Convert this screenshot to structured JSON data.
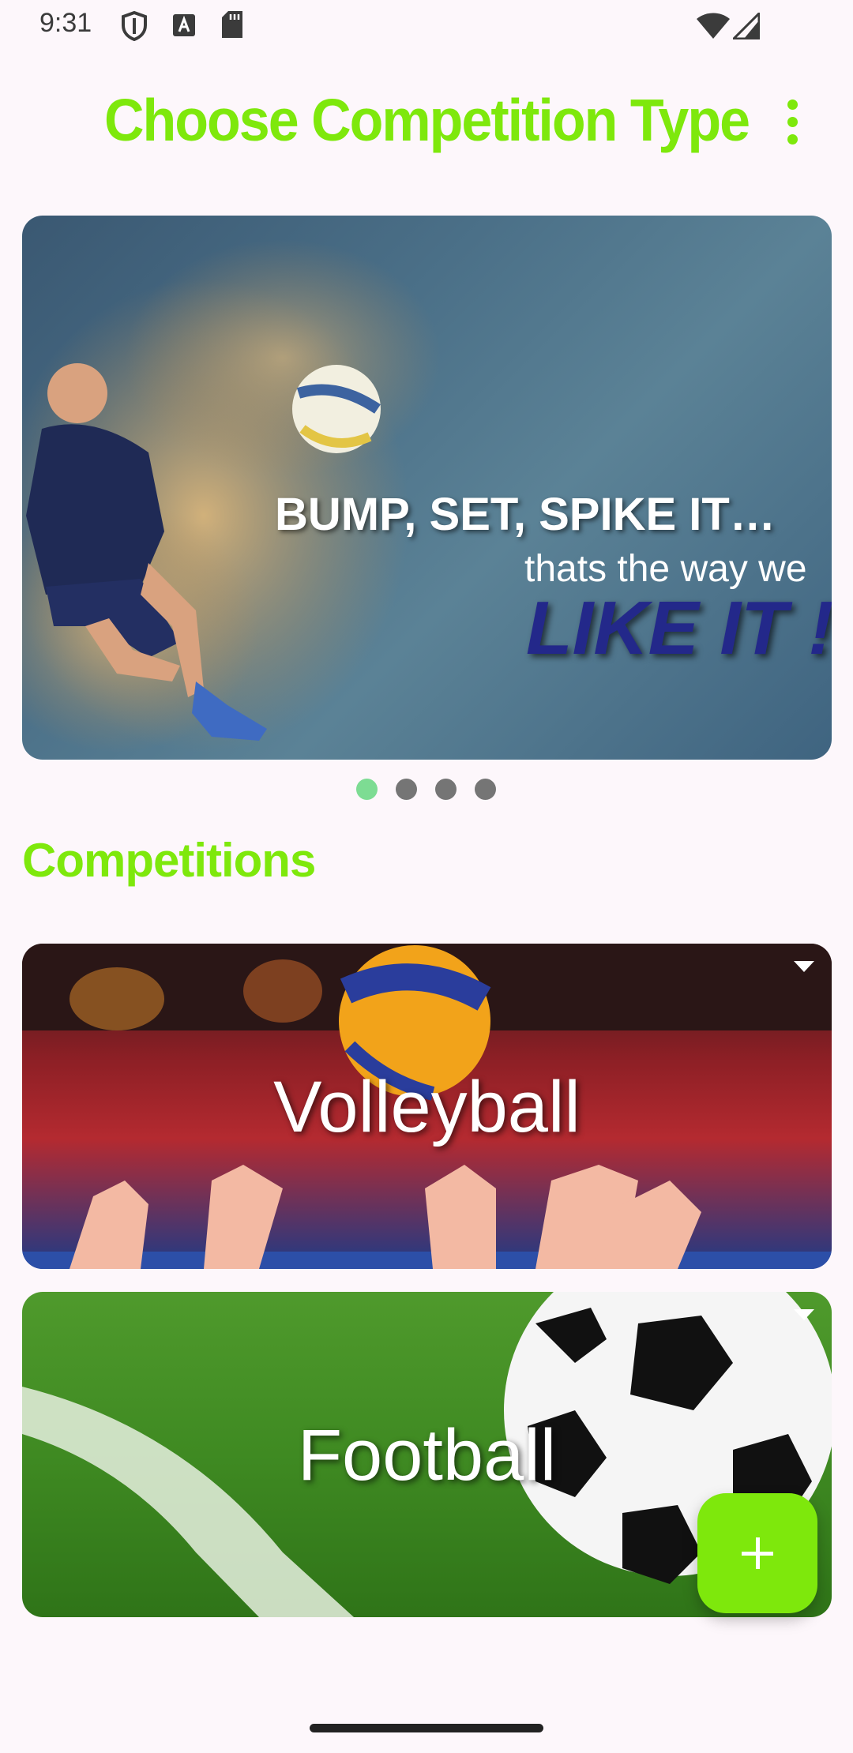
{
  "status_bar": {
    "time": "9:31",
    "icons": [
      "shield-icon",
      "font-a-icon",
      "sd-card-icon",
      "wifi-icon",
      "signal-icon"
    ]
  },
  "app_bar": {
    "title": "Choose Competition Type",
    "menu_icon": "more-vert-icon"
  },
  "carousel": {
    "banner_line_1": "BUMP, SET, SPIKE IT…",
    "banner_line_2": "thats the way we",
    "banner_line_3": "LIKE IT !",
    "page_count": 4,
    "active_index": 0
  },
  "section": {
    "title": "Competitions"
  },
  "competitions": [
    {
      "label": "Volleyball"
    },
    {
      "label": "Football"
    }
  ],
  "fab": {
    "icon": "plus-icon"
  },
  "colors": {
    "accent": "#7ee80c",
    "dot_active": "#7ddc93",
    "dot_inactive": "#757575",
    "background": "#fdf7fb"
  }
}
